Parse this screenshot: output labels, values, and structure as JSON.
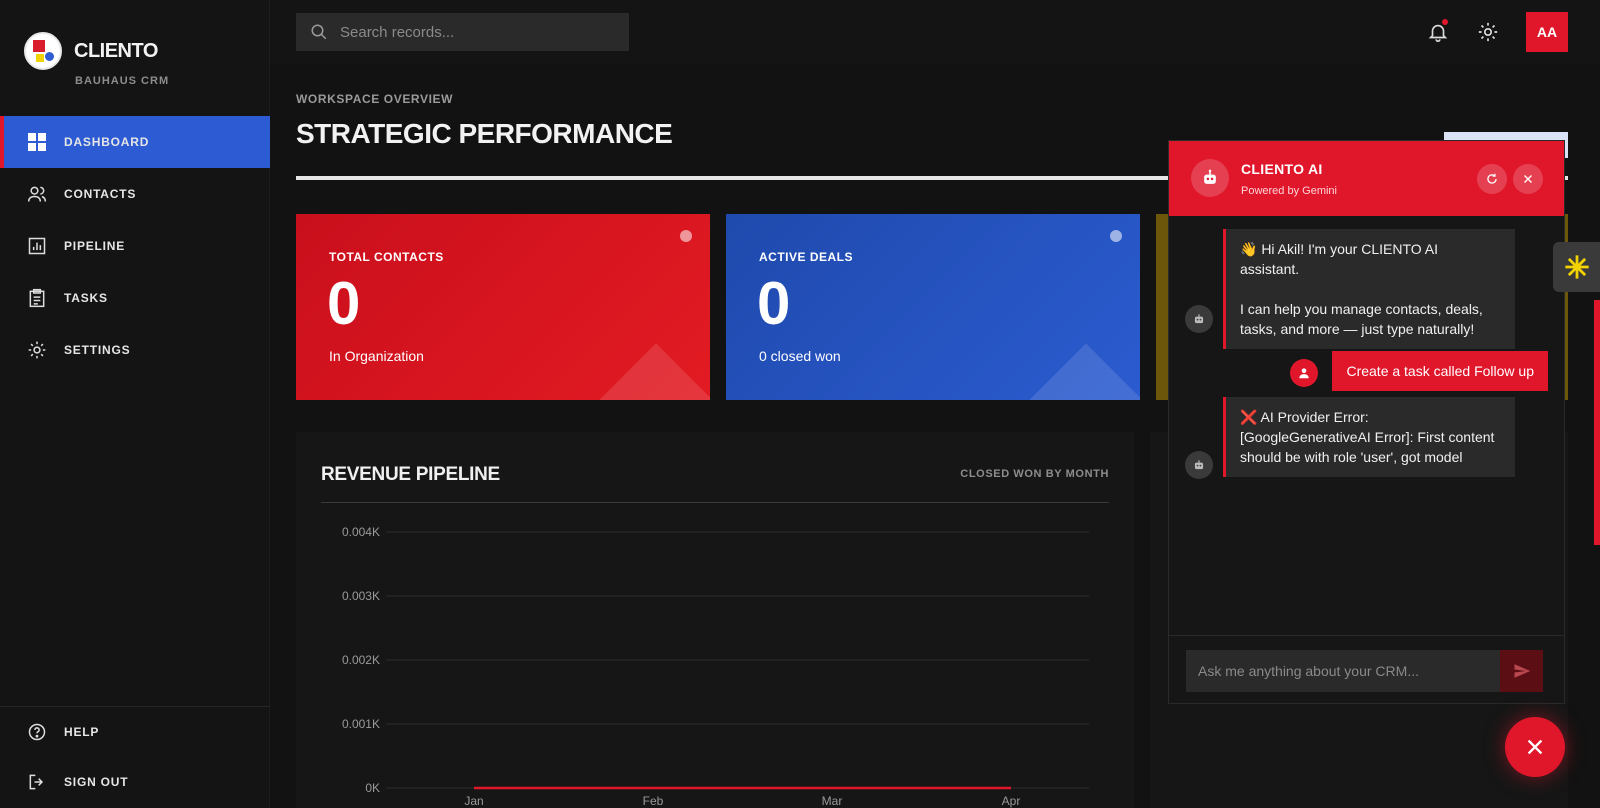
{
  "brand": {
    "name": "CLIENTO",
    "subtitle": "BAUHAUS CRM"
  },
  "nav": {
    "items": [
      {
        "label": "DASHBOARD",
        "icon": "grid-icon",
        "active": true
      },
      {
        "label": "CONTACTS",
        "icon": "users-icon"
      },
      {
        "label": "PIPELINE",
        "icon": "chart-icon"
      },
      {
        "label": "TASKS",
        "icon": "clipboard-icon"
      },
      {
        "label": "SETTINGS",
        "icon": "gear-icon"
      }
    ],
    "bottom": [
      {
        "label": "HELP",
        "icon": "help-icon"
      },
      {
        "label": "SIGN OUT",
        "icon": "sign-out-icon"
      }
    ]
  },
  "topbar": {
    "search_placeholder": "Search records...",
    "avatar_initials": "AA"
  },
  "header": {
    "eyebrow": "WORKSPACE OVERVIEW",
    "title": "STRATEGIC PERFORMANCE"
  },
  "cards": [
    {
      "label": "TOTAL CONTACTS",
      "value": "0",
      "sub": "In Organization",
      "color": "#e0162b"
    },
    {
      "label": "ACTIVE DEALS",
      "value": "0",
      "sub": "0 closed won",
      "color": "#2c5bd4"
    }
  ],
  "revenue_panel": {
    "title": "REVENUE PIPELINE",
    "meta": "CLOSED WON BY MONTH"
  },
  "chart_data": {
    "type": "line",
    "categories": [
      "Jan",
      "Feb",
      "Mar",
      "Apr"
    ],
    "series": [
      {
        "values": [
          0,
          0,
          0,
          0
        ],
        "color": "#e0162b"
      }
    ],
    "y_ticks": [
      "0K",
      "0.001K",
      "0.002K",
      "0.003K",
      "0.004K"
    ],
    "ylim": [
      0,
      0.004
    ],
    "grid": true
  },
  "chat": {
    "title": "CLIENTO AI",
    "subtitle": "Powered by Gemini",
    "messages": [
      {
        "role": "bot",
        "lines": [
          "👋 Hi Akil! I'm your CLIENTO AI assistant.",
          "I can help you manage contacts, deals, tasks, and more — just type naturally!"
        ]
      },
      {
        "role": "user",
        "text": "Create a task called Follow up"
      },
      {
        "role": "bot",
        "lines": [
          "❌ AI Provider Error: [GoogleGenerativeAI Error]: First content should be with role 'user', got model"
        ]
      }
    ],
    "input_placeholder": "Ask me anything about your CRM..."
  },
  "colors": {
    "accent_red": "#e0162b",
    "accent_blue": "#2c5bd4",
    "accent_yellow": "#f2d200",
    "background": "#121212"
  }
}
